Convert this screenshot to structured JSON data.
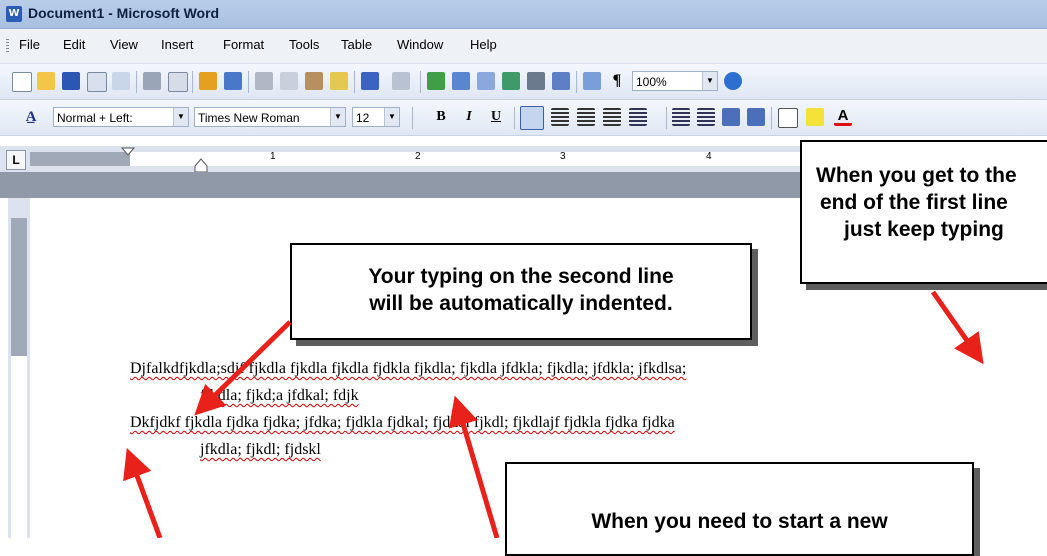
{
  "window": {
    "app_icon": "W",
    "title": "Document1 - Microsoft Word"
  },
  "menu": [
    "File",
    "Edit",
    "View",
    "Insert",
    "Format",
    "Tools",
    "Table",
    "Window",
    "Help"
  ],
  "standard_toolbar": {
    "zoom": "100%"
  },
  "formatting_toolbar": {
    "style": "Normal + Left:",
    "font": "Times New Roman",
    "size": "12",
    "bold": "B",
    "italic": "I",
    "underline": "U",
    "styles_icon": "A̲"
  },
  "ruler": {
    "tab_selector": "L",
    "numbers": [
      "1",
      "2",
      "3",
      "4"
    ]
  },
  "document": {
    "lines": [
      "Djfalkdfjkdla;sdjf fjkdla fjkdla fjkdla fjdkla fjkdla; fjkdla jfdkla; fjkdla; jfdkla; jfkdlsa;",
      "fjkdla; fjkd;a jfdkal; fdjk",
      "Dkfjdkf fjkdla fjdka fjdka; jfdka; fjdkla fjdkal; fjdkal fjkdl; fjkdlajf fjdkla fjdka fjdka",
      "jfkdla; fjkdl; fjdskl"
    ]
  },
  "callouts": {
    "indent": [
      "Your typing on the second line",
      "will be automatically indented."
    ],
    "keep_typing": [
      "When you get to the",
      "end of the first line",
      "just keep typing"
    ],
    "new_line": [
      "When you need to start a new"
    ]
  },
  "colors": {
    "arrow": "#e8211b",
    "titlebar": "#b9cde8",
    "toolbar": "#e6ecf5"
  }
}
